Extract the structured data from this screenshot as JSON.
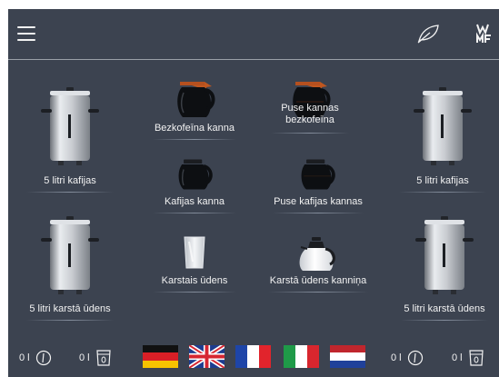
{
  "header": {
    "menu_icon": "hamburger-menu-icon",
    "eco_icon": "leaf-icon",
    "logo_text": "WMF"
  },
  "tiles": {
    "left_top": {
      "label": "5 litri kafijas",
      "icon": "urn-icon"
    },
    "left_bottom": {
      "label": "5 litri karstā ūdens",
      "icon": "urn-icon"
    },
    "right_top": {
      "label": "5 litri kafijas",
      "icon": "urn-icon"
    },
    "right_bottom": {
      "label": "5 litri karstā ūdens",
      "icon": "urn-icon"
    },
    "decaf_jug": {
      "label": "Bezkofeīna kanna",
      "icon": "coffee-jug-decaf-icon"
    },
    "half_decaf_jug": {
      "label_line1": "Puse kannas",
      "label_line2": "bezkofeīna",
      "icon": "coffee-jug-decaf-icon"
    },
    "coffee_jug": {
      "label": "Kafijas kanna",
      "icon": "coffee-jug-icon"
    },
    "half_coffee_jug": {
      "label": "Puse kafijas kannas",
      "icon": "coffee-jug-icon"
    },
    "cold_water": {
      "label": "Karstais ūdens",
      "icon": "glass-icon"
    },
    "hot_water_jug": {
      "label": "Karstā ūdens kanniņa",
      "icon": "water-jug-icon"
    }
  },
  "bottom": {
    "left_counter_1": "0 l",
    "left_counter_2": "0 l",
    "right_counter_1": "0 l",
    "right_counter_2": "0 l",
    "languages": [
      "German",
      "English",
      "French",
      "Italian",
      "Dutch"
    ]
  },
  "colors": {
    "background": "#3c4350",
    "text": "#f2f2f2",
    "decaf_accent": "#b5501f"
  }
}
